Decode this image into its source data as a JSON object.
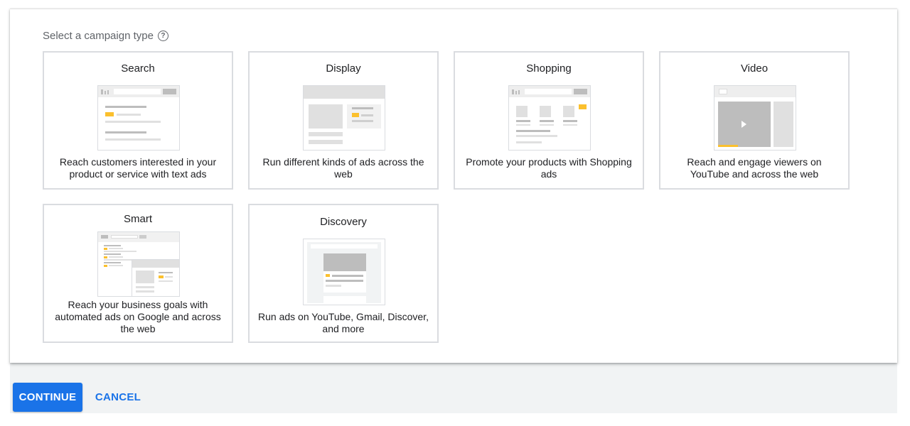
{
  "heading": {
    "text": "Select a campaign type",
    "help_icon": "help-circle-icon",
    "help_glyph": "?"
  },
  "campaign_types": [
    {
      "title": "Search",
      "description": "Reach customers interested in your product or service with text ads"
    },
    {
      "title": "Display",
      "description": "Run different kinds of ads across the web"
    },
    {
      "title": "Shopping",
      "description": "Promote your products with Shopping ads"
    },
    {
      "title": "Video",
      "description": "Reach and engage viewers on YouTube and across the web"
    },
    {
      "title": "Smart",
      "description": "Reach your business goals with automated ads on Google and across the web"
    },
    {
      "title": "Discovery",
      "description": "Run ads on YouTube, Gmail, Discover, and more"
    }
  ],
  "actions": {
    "continue_label": "CONTINUE",
    "cancel_label": "CANCEL"
  },
  "colors": {
    "accent": "#1a73e8",
    "highlight": "#fbc02d",
    "card_border": "#dadce0",
    "footer_bg": "#f1f3f4"
  }
}
